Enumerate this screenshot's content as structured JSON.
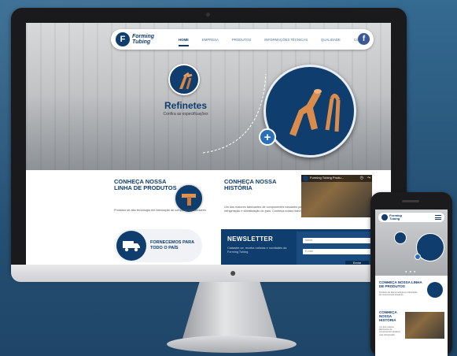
{
  "brand": {
    "name": "Forming Tubing",
    "logo_letter": "F"
  },
  "nav": {
    "items": [
      {
        "label": "HOME",
        "active": true
      },
      {
        "label": "EMPRESA"
      },
      {
        "label": "PRODUTOS"
      },
      {
        "label": "INFORMAÇÕES TÉCNICAS"
      },
      {
        "label": "QUALIDADE"
      },
      {
        "label": "CONTATO"
      }
    ],
    "facebook": "f"
  },
  "hero": {
    "title": "Refinetes",
    "subtitle": "Confira as especificações",
    "plus": "+"
  },
  "section_products": {
    "title": "CONHEÇA NOSSA LINHA DE PRODUTOS",
    "text": "Produtos de alta tecnologia em fabricação de componentes tubulares."
  },
  "section_history": {
    "title": "CONHEÇA NOSSA HISTÓRIA",
    "text": "Um dos maiores fabricantes de componentes tubulares para refrigeração e climatização do país. Conheça nossa história."
  },
  "video": {
    "title": "Forming Tubing Produ...",
    "share": "⋯"
  },
  "shipping": {
    "text": "FORNECEMOS PARA TODO O PAÍS"
  },
  "newsletter": {
    "title": "NEWSLETTER",
    "text": "Cadastre-se, receba notícias e novidades da Forming Tubing",
    "name_placeholder": "Nome",
    "email_placeholder": "E-mail",
    "button": "Enviar"
  },
  "phone": {
    "brand": "Forming Tubing",
    "section_products": "CONHEÇA NOSSA LINHA DE PRODUTOS",
    "section_products_text": "Produtos de alta tecnologia em fabricação de componentes tubulares.",
    "section_history": "CONHEÇA NOSSA HISTÓRIA",
    "section_history_text": "Um dos maiores fabricantes de componentes tubulares para refrigeração.",
    "dots": "● ● ●"
  },
  "colors": {
    "brand_navy": "#0f3d6e",
    "accent_blue": "#2a6fb8",
    "background": "#2b5a80"
  },
  "icons": [
    "facebook-icon",
    "plus-icon",
    "tee-fitting-icon",
    "truck-icon",
    "apple-logo-icon",
    "menu-icon"
  ]
}
